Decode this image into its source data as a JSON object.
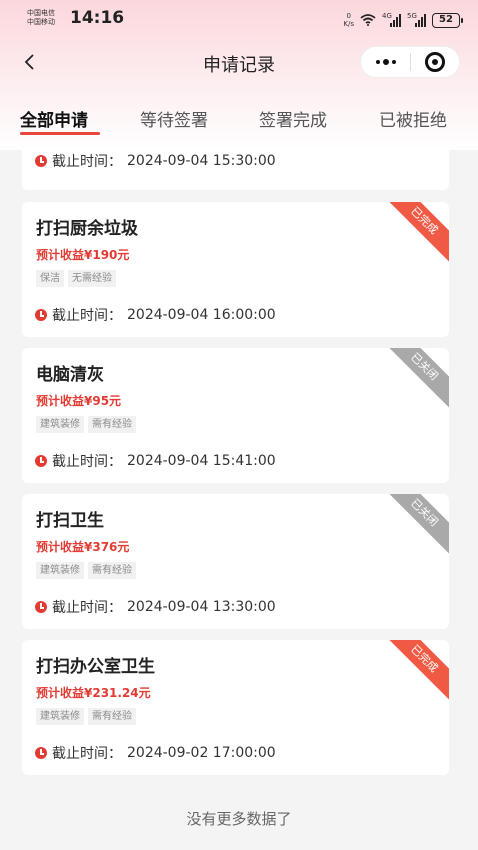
{
  "status_bar": {
    "carrier1": "中国电信",
    "carrier2": "中国移动",
    "time": "14:16",
    "speed_value": "0",
    "speed_unit": "K/s",
    "sig1_label": "4G",
    "sig2_label": "5G",
    "battery": "52"
  },
  "nav": {
    "title": "申请记录"
  },
  "tabs": [
    {
      "label": "全部申请",
      "active": true
    },
    {
      "label": "等待签署",
      "active": false
    },
    {
      "label": "签署完成",
      "active": false
    },
    {
      "label": "已被拒绝",
      "active": false
    }
  ],
  "deadline_label": "截止时间：",
  "cards": [
    {
      "deadline": "2024-09-04 15:30:00"
    },
    {
      "title": "打扫厨余垃圾",
      "income": "预计收益¥190元",
      "tags": [
        "保洁",
        "无需经验"
      ],
      "deadline": "2024-09-04 16:00:00",
      "status": "已完成",
      "status_color": "#f05a45"
    },
    {
      "title": "电脑清灰",
      "income": "预计收益¥95元",
      "tags": [
        "建筑装修",
        "需有经验"
      ],
      "deadline": "2024-09-04 15:41:00",
      "status": "已关闭",
      "status_color": "#a9a9a9"
    },
    {
      "title": "打扫卫生",
      "income": "预计收益¥376元",
      "tags": [
        "建筑装修",
        "需有经验"
      ],
      "deadline": "2024-09-04 13:30:00",
      "status": "已关闭",
      "status_color": "#a9a9a9"
    },
    {
      "title": "打扫办公室卫生",
      "income": "预计收益¥231.24元",
      "tags": [
        "建筑装修",
        "需有经验"
      ],
      "deadline": "2024-09-02 17:00:00",
      "status": "已完成",
      "status_color": "#f05a45"
    }
  ],
  "footer": "没有更多数据了"
}
